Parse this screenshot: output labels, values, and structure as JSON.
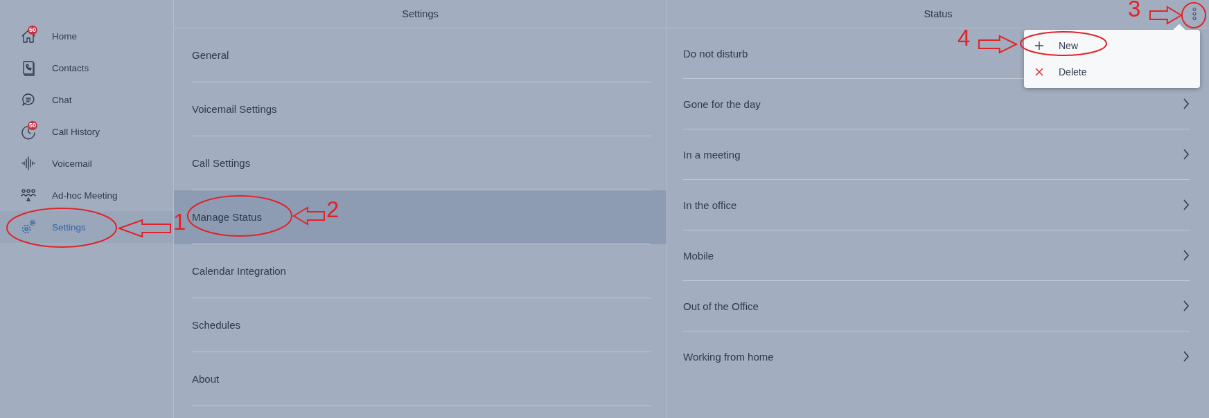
{
  "sidebar": {
    "items": [
      {
        "label": "Home",
        "kind": "home",
        "badge": "50",
        "selected": false
      },
      {
        "label": "Contacts",
        "kind": "contacts",
        "selected": false
      },
      {
        "label": "Chat",
        "kind": "chat",
        "selected": false
      },
      {
        "label": "Call History",
        "kind": "history",
        "badge": "50",
        "selected": false
      },
      {
        "label": "Voicemail",
        "kind": "voicemail",
        "selected": false
      },
      {
        "label": "Ad-hoc Meeting",
        "kind": "meeting",
        "selected": false
      },
      {
        "label": "Settings",
        "kind": "settings",
        "selected": true
      }
    ]
  },
  "settings_panel": {
    "title": "Settings",
    "items": [
      {
        "label": "General",
        "selected": false
      },
      {
        "label": "Voicemail Settings",
        "selected": false
      },
      {
        "label": "Call Settings",
        "selected": false
      },
      {
        "label": "Manage Status",
        "selected": true
      },
      {
        "label": "Calendar Integration",
        "selected": false
      },
      {
        "label": "Schedules",
        "selected": false
      },
      {
        "label": "About",
        "selected": false
      }
    ]
  },
  "status_panel": {
    "title": "Status",
    "items": [
      {
        "label": "Do not disturb"
      },
      {
        "label": "Gone for the day",
        "chevron": true
      },
      {
        "label": "In a meeting",
        "chevron": true
      },
      {
        "label": "In the office",
        "chevron": true
      },
      {
        "label": "Mobile",
        "chevron": true
      },
      {
        "label": "Out of the Office",
        "chevron": true
      },
      {
        "label": "Working from home",
        "chevron": true
      }
    ]
  },
  "menu": {
    "items": [
      {
        "label": "New",
        "kind": "add"
      },
      {
        "label": "Delete",
        "kind": "delete"
      }
    ]
  },
  "annotations": [
    {
      "label": "1"
    },
    {
      "label": "2"
    },
    {
      "label": "3"
    },
    {
      "label": "4"
    }
  ]
}
